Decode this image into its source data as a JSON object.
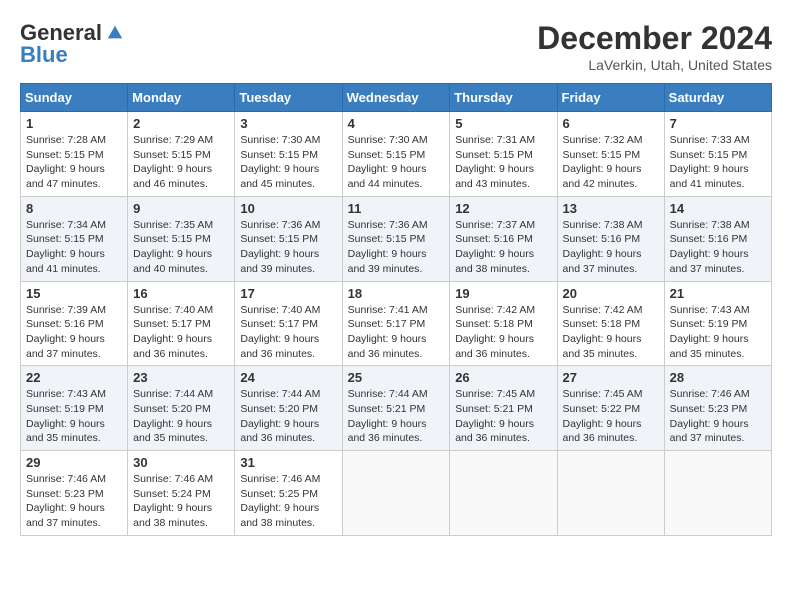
{
  "header": {
    "logo_general": "General",
    "logo_blue": "Blue",
    "month": "December 2024",
    "location": "LaVerkin, Utah, United States"
  },
  "weekdays": [
    "Sunday",
    "Monday",
    "Tuesday",
    "Wednesday",
    "Thursday",
    "Friday",
    "Saturday"
  ],
  "weeks": [
    [
      {
        "day": "1",
        "sunrise": "7:28 AM",
        "sunset": "5:15 PM",
        "daylight": "9 hours and 47 minutes."
      },
      {
        "day": "2",
        "sunrise": "7:29 AM",
        "sunset": "5:15 PM",
        "daylight": "9 hours and 46 minutes."
      },
      {
        "day": "3",
        "sunrise": "7:30 AM",
        "sunset": "5:15 PM",
        "daylight": "9 hours and 45 minutes."
      },
      {
        "day": "4",
        "sunrise": "7:30 AM",
        "sunset": "5:15 PM",
        "daylight": "9 hours and 44 minutes."
      },
      {
        "day": "5",
        "sunrise": "7:31 AM",
        "sunset": "5:15 PM",
        "daylight": "9 hours and 43 minutes."
      },
      {
        "day": "6",
        "sunrise": "7:32 AM",
        "sunset": "5:15 PM",
        "daylight": "9 hours and 42 minutes."
      },
      {
        "day": "7",
        "sunrise": "7:33 AM",
        "sunset": "5:15 PM",
        "daylight": "9 hours and 41 minutes."
      }
    ],
    [
      {
        "day": "8",
        "sunrise": "7:34 AM",
        "sunset": "5:15 PM",
        "daylight": "9 hours and 41 minutes."
      },
      {
        "day": "9",
        "sunrise": "7:35 AM",
        "sunset": "5:15 PM",
        "daylight": "9 hours and 40 minutes."
      },
      {
        "day": "10",
        "sunrise": "7:36 AM",
        "sunset": "5:15 PM",
        "daylight": "9 hours and 39 minutes."
      },
      {
        "day": "11",
        "sunrise": "7:36 AM",
        "sunset": "5:15 PM",
        "daylight": "9 hours and 39 minutes."
      },
      {
        "day": "12",
        "sunrise": "7:37 AM",
        "sunset": "5:16 PM",
        "daylight": "9 hours and 38 minutes."
      },
      {
        "day": "13",
        "sunrise": "7:38 AM",
        "sunset": "5:16 PM",
        "daylight": "9 hours and 37 minutes."
      },
      {
        "day": "14",
        "sunrise": "7:38 AM",
        "sunset": "5:16 PM",
        "daylight": "9 hours and 37 minutes."
      }
    ],
    [
      {
        "day": "15",
        "sunrise": "7:39 AM",
        "sunset": "5:16 PM",
        "daylight": "9 hours and 37 minutes."
      },
      {
        "day": "16",
        "sunrise": "7:40 AM",
        "sunset": "5:17 PM",
        "daylight": "9 hours and 36 minutes."
      },
      {
        "day": "17",
        "sunrise": "7:40 AM",
        "sunset": "5:17 PM",
        "daylight": "9 hours and 36 minutes."
      },
      {
        "day": "18",
        "sunrise": "7:41 AM",
        "sunset": "5:17 PM",
        "daylight": "9 hours and 36 minutes."
      },
      {
        "day": "19",
        "sunrise": "7:42 AM",
        "sunset": "5:18 PM",
        "daylight": "9 hours and 36 minutes."
      },
      {
        "day": "20",
        "sunrise": "7:42 AM",
        "sunset": "5:18 PM",
        "daylight": "9 hours and 35 minutes."
      },
      {
        "day": "21",
        "sunrise": "7:43 AM",
        "sunset": "5:19 PM",
        "daylight": "9 hours and 35 minutes."
      }
    ],
    [
      {
        "day": "22",
        "sunrise": "7:43 AM",
        "sunset": "5:19 PM",
        "daylight": "9 hours and 35 minutes."
      },
      {
        "day": "23",
        "sunrise": "7:44 AM",
        "sunset": "5:20 PM",
        "daylight": "9 hours and 35 minutes."
      },
      {
        "day": "24",
        "sunrise": "7:44 AM",
        "sunset": "5:20 PM",
        "daylight": "9 hours and 36 minutes."
      },
      {
        "day": "25",
        "sunrise": "7:44 AM",
        "sunset": "5:21 PM",
        "daylight": "9 hours and 36 minutes."
      },
      {
        "day": "26",
        "sunrise": "7:45 AM",
        "sunset": "5:21 PM",
        "daylight": "9 hours and 36 minutes."
      },
      {
        "day": "27",
        "sunrise": "7:45 AM",
        "sunset": "5:22 PM",
        "daylight": "9 hours and 36 minutes."
      },
      {
        "day": "28",
        "sunrise": "7:46 AM",
        "sunset": "5:23 PM",
        "daylight": "9 hours and 37 minutes."
      }
    ],
    [
      {
        "day": "29",
        "sunrise": "7:46 AM",
        "sunset": "5:23 PM",
        "daylight": "9 hours and 37 minutes."
      },
      {
        "day": "30",
        "sunrise": "7:46 AM",
        "sunset": "5:24 PM",
        "daylight": "9 hours and 38 minutes."
      },
      {
        "day": "31",
        "sunrise": "7:46 AM",
        "sunset": "5:25 PM",
        "daylight": "9 hours and 38 minutes."
      },
      null,
      null,
      null,
      null
    ]
  ]
}
